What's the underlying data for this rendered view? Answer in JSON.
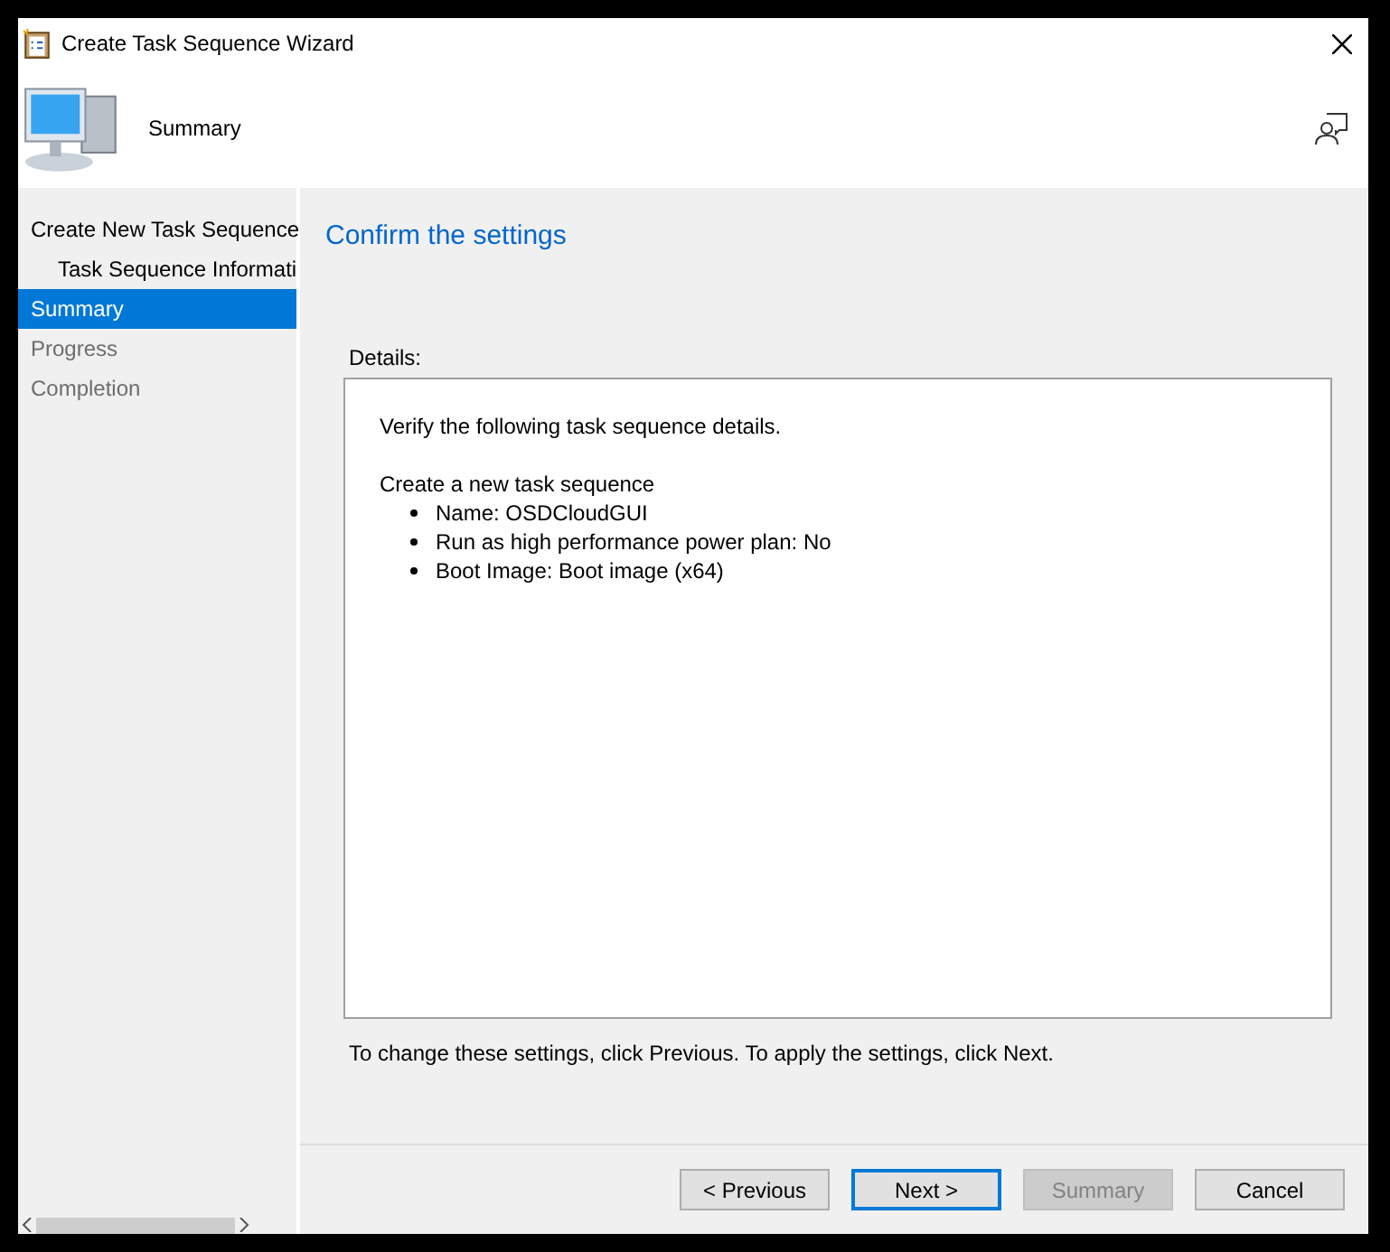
{
  "window": {
    "title": "Create Task Sequence Wizard"
  },
  "header": {
    "title": "Summary"
  },
  "sidebar": {
    "items": [
      {
        "label": "Create New Task Sequence",
        "selected": false,
        "disabled": false,
        "children": [
          {
            "label": "Task Sequence Informati",
            "selected": false,
            "disabled": false
          }
        ]
      },
      {
        "label": "Summary",
        "selected": true,
        "disabled": false
      },
      {
        "label": "Progress",
        "selected": false,
        "disabled": true
      },
      {
        "label": "Completion",
        "selected": false,
        "disabled": true
      }
    ]
  },
  "page": {
    "heading": "Confirm the settings",
    "details_label": "Details:",
    "details": {
      "intro": "Verify the following task sequence details.",
      "section": "Create a new task sequence",
      "items": [
        "Name: OSDCloudGUI",
        "Run as high performance power plan: No",
        "Boot Image: Boot image (x64)"
      ]
    },
    "note": "To change these settings, click Previous. To apply the settings, click Next."
  },
  "buttons": [
    {
      "label": "< Previous",
      "default": false,
      "disabled": false
    },
    {
      "label": "Next >",
      "default": true,
      "disabled": false
    },
    {
      "label": "Summary",
      "default": false,
      "disabled": true
    },
    {
      "label": "Cancel",
      "default": false,
      "disabled": false
    }
  ]
}
